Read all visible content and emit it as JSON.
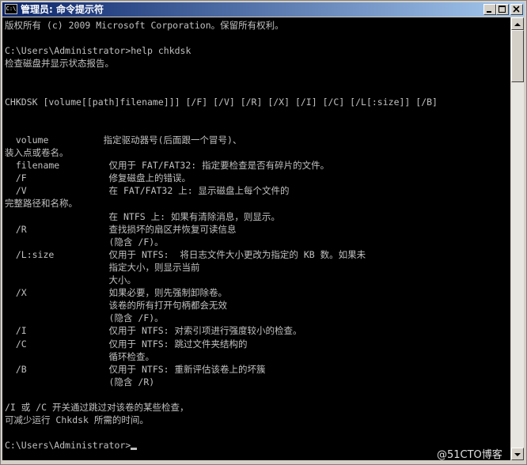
{
  "window": {
    "title": "管理员: 命令提示符",
    "icon_label": "C:\\"
  },
  "console": {
    "lines": [
      "版权所有 (c) 2009 Microsoft Corporation。保留所有权利。",
      "",
      "C:\\Users\\Administrator>help chkdsk",
      "检查磁盘并显示状态报告。",
      "",
      "",
      "CHKDSK [volume[[path]filename]]] [/F] [/V] [/R] [/X] [/I] [/C] [/L[:size]] [/B]",
      "",
      "",
      "  volume          指定驱动器号(后面跟一个冒号)、",
      "装入点或卷名。",
      "  filename         仅用于 FAT/FAT32: 指定要检查是否有碎片的文件。",
      "  /F               修复磁盘上的错误。",
      "  /V               在 FAT/FAT32 上: 显示磁盘上每个文件的",
      "完整路径和名称。",
      "                   在 NTFS 上: 如果有清除消息，则显示。",
      "  /R               查找损坏的扇区并恢复可读信息",
      "                   (隐含 /F)。",
      "  /L:size          仅用于 NTFS:  将日志文件大小更改为指定的 KB 数。如果未",
      "                   指定大小，则显示当前",
      "                   大小。",
      "  /X               如果必要，则先强制卸除卷。",
      "                   该卷的所有打开句柄都会无效",
      "                   (隐含 /F)。",
      "  /I               仅用于 NTFS: 对索引项进行强度较小的检查。",
      "  /C               仅用于 NTFS: 跳过文件夹结构的",
      "                   循环检查。",
      "  /B               仅用于 NTFS: 重新评估该卷上的坏簇",
      "                   (隐含 /R)",
      "",
      "/I 或 /C 开关通过跳过对该卷的某些检查，",
      "可减少运行 Chkdsk 所需的时间。",
      "",
      "C:\\Users\\Administrator>"
    ]
  },
  "watermark": "@51CTO博客",
  "colors": {
    "console_bg": "#000000",
    "console_text": "#c0c0c0",
    "title_gradient_start": "#0a246a",
    "title_gradient_end": "#a6caf0"
  }
}
